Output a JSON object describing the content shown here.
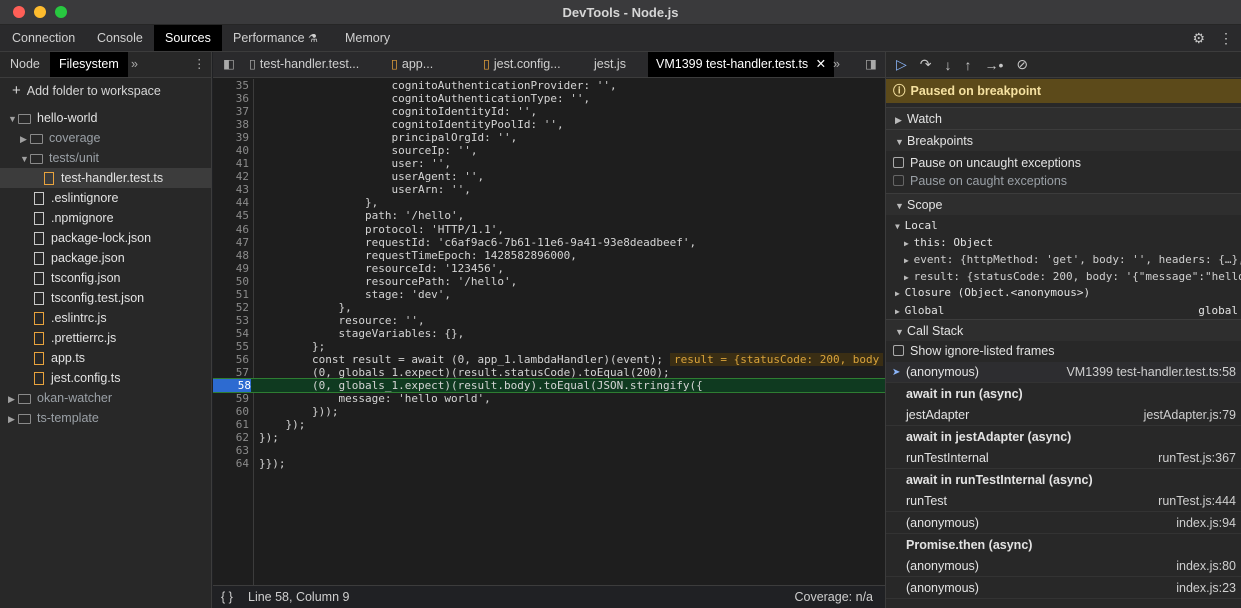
{
  "window": {
    "title": "DevTools - Node.js"
  },
  "main_tabs": [
    "Connection",
    "Console",
    "Sources",
    "Performance",
    "Memory"
  ],
  "left": {
    "tabs": [
      "Node",
      "Filesystem"
    ],
    "add_folder": "Add folder to workspace",
    "tree": [
      {
        "label": "hello-world",
        "type": "folder",
        "open": true
      },
      {
        "label": "coverage",
        "type": "folder",
        "open": false
      },
      {
        "label": "tests/unit",
        "type": "folder",
        "open": true
      },
      {
        "label": "test-handler.test.ts",
        "type": "file",
        "selected": true
      },
      {
        "label": ".eslintignore",
        "type": "file"
      },
      {
        "label": ".npmignore",
        "type": "file"
      },
      {
        "label": "package-lock.json",
        "type": "file"
      },
      {
        "label": "package.json",
        "type": "file"
      },
      {
        "label": "tsconfig.json",
        "type": "file"
      },
      {
        "label": "tsconfig.test.json",
        "type": "file"
      },
      {
        "label": ".eslintrc.js",
        "type": "file"
      },
      {
        "label": ".prettierrc.js",
        "type": "file"
      },
      {
        "label": "app.ts",
        "type": "file"
      },
      {
        "label": "jest.config.ts",
        "type": "file"
      },
      {
        "label": "okan-watcher",
        "type": "folder",
        "open": false
      },
      {
        "label": "ts-template",
        "type": "folder",
        "open": false
      }
    ]
  },
  "editor": {
    "tabs": [
      "test-handler.test...",
      "app...",
      "jest.config...",
      "jest.js",
      "VM1399 test-handler.test.ts"
    ],
    "lines": [
      {
        "n": "35",
        "t": "                    cognitoAuthenticationProvider: '',"
      },
      {
        "n": "36",
        "t": "                    cognitoAuthenticationType: '',"
      },
      {
        "n": "37",
        "t": "                    cognitoIdentityId: '',"
      },
      {
        "n": "38",
        "t": "                    cognitoIdentityPoolId: '',"
      },
      {
        "n": "39",
        "t": "                    principalOrgId: '',"
      },
      {
        "n": "40",
        "t": "                    sourceIp: '',"
      },
      {
        "n": "41",
        "t": "                    user: '',"
      },
      {
        "n": "42",
        "t": "                    userAgent: '',"
      },
      {
        "n": "43",
        "t": "                    userArn: '',"
      },
      {
        "n": "44",
        "t": "                },"
      },
      {
        "n": "45",
        "t": "                path: '/hello',"
      },
      {
        "n": "46",
        "t": "                protocol: 'HTTP/1.1',"
      },
      {
        "n": "47",
        "t": "                requestId: 'c6af9ac6-7b61-11e6-9a41-93e8deadbeef',"
      },
      {
        "n": "48",
        "t": "                requestTimeEpoch: 1428582896000,"
      },
      {
        "n": "49",
        "t": "                resourceId: '123456',"
      },
      {
        "n": "50",
        "t": "                resourcePath: '/hello',"
      },
      {
        "n": "51",
        "t": "                stage: 'dev',"
      },
      {
        "n": "52",
        "t": "            },"
      },
      {
        "n": "53",
        "t": "            resource: '',"
      },
      {
        "n": "54",
        "t": "            stageVariables: {},"
      },
      {
        "n": "55",
        "t": "        };"
      },
      {
        "n": "56",
        "t": "        const result = await (0, app_1.lambdaHandler)(event);"
      },
      {
        "n": "57",
        "t": "        (0, globals_1.expect)(result.statusCode).toEqual(200);"
      },
      {
        "n": "58",
        "t": "        (0, globals_1.expect)(result.body).toEqual(JSON.stringify({"
      },
      {
        "n": "59",
        "t": "            message: 'hello world',"
      },
      {
        "n": "60",
        "t": "        }));"
      },
      {
        "n": "61",
        "t": "    });"
      },
      {
        "n": "62",
        "t": "});"
      },
      {
        "n": "63",
        "t": ""
      },
      {
        "n": "64",
        "t": "}});"
      }
    ],
    "inline_value": "result = {statusCode: 200, body",
    "status_position": "Line 58, Column 9",
    "status_coverage": "Coverage: n/a"
  },
  "right": {
    "paused": "Paused on breakpoint",
    "watch": "Watch",
    "breakpoints": "Breakpoints",
    "pause_uncaught": "Pause on uncaught exceptions",
    "pause_caught": "Pause on caught exceptions",
    "scope": "Scope",
    "local": "Local",
    "this_row": "this: Object",
    "event_row": "event: {httpMethod: 'get', body: '', headers: {…},",
    "result_row": "result: {statusCode: 200, body: '{\"message\":\"hello",
    "closure": "Closure (Object.<anonymous>)",
    "global": "Global",
    "global_val": "global",
    "callstack": "Call Stack",
    "show_ignored": "Show ignore-listed frames",
    "frames": [
      {
        "name": "(anonymous)",
        "loc": "VM1399 test-handler.test.ts:58",
        "cur": true
      },
      {
        "name": "await in run (async)",
        "sep": true
      },
      {
        "name": "jestAdapter",
        "loc": "jestAdapter.js:79"
      },
      {
        "name": "await in jestAdapter (async)",
        "sep": true
      },
      {
        "name": "runTestInternal",
        "loc": "runTest.js:367"
      },
      {
        "name": "await in runTestInternal (async)",
        "sep": true
      },
      {
        "name": "runTest",
        "loc": "runTest.js:444"
      },
      {
        "name": "(anonymous)",
        "loc": "index.js:94"
      },
      {
        "name": "Promise.then (async)",
        "sep": true
      },
      {
        "name": "(anonymous)",
        "loc": "index.js:80"
      },
      {
        "name": "(anonymous)",
        "loc": "index.js:23"
      }
    ]
  }
}
